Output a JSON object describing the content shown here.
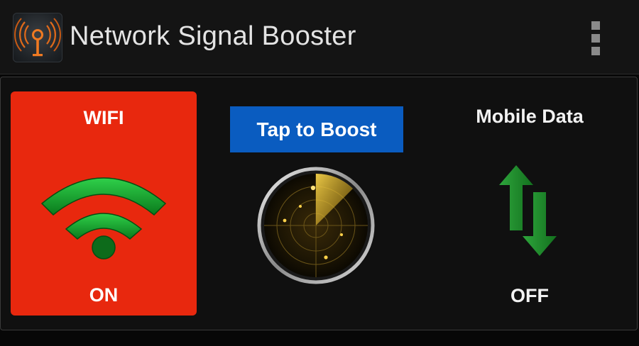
{
  "app": {
    "title": "Network Signal Booster",
    "icon": "antenna-icon"
  },
  "menu": {
    "icon": "overflow-menu-icon"
  },
  "wifi": {
    "label": "WIFI",
    "status": "ON",
    "icon": "wifi-icon",
    "card_color": "#e8280e",
    "icon_color": "#14a02a"
  },
  "boost": {
    "label": "Tap to Boost",
    "button_color": "#0a5cc0",
    "radar_icon": "radar-icon"
  },
  "mobile_data": {
    "label": "Mobile Data",
    "status": "OFF",
    "icon": "data-arrows-icon",
    "icon_color": "#1f8a2a"
  }
}
